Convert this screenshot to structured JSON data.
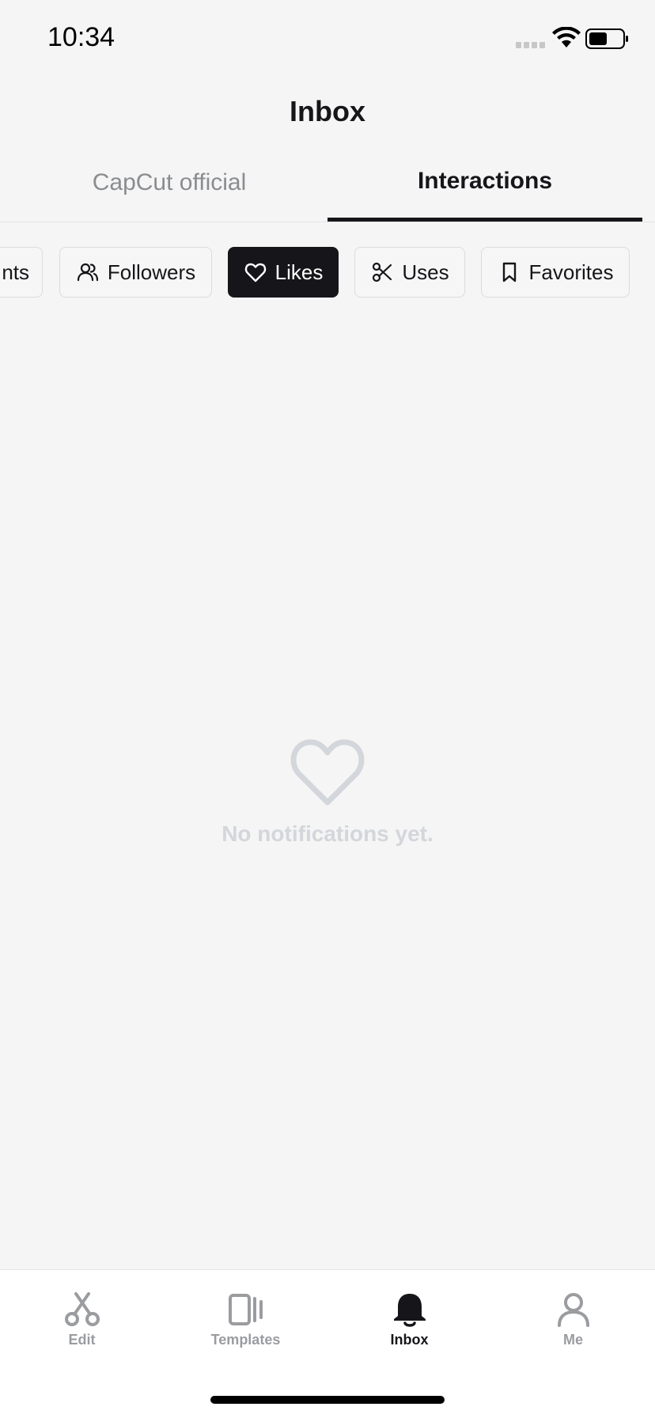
{
  "status_bar": {
    "time": "10:34"
  },
  "header": {
    "title": "Inbox"
  },
  "top_tabs": [
    {
      "label": "CapCut official",
      "selected": false
    },
    {
      "label": "Interactions",
      "selected": true
    }
  ],
  "filter_chips": [
    {
      "label": "nts",
      "icon": "truncated",
      "selected": false
    },
    {
      "label": "Followers",
      "icon": "users-icon",
      "selected": false
    },
    {
      "label": "Likes",
      "icon": "heart-icon",
      "selected": true
    },
    {
      "label": "Uses",
      "icon": "scissors-icon",
      "selected": false
    },
    {
      "label": "Favorites",
      "icon": "bookmark-icon",
      "selected": false
    }
  ],
  "empty_state": {
    "icon": "heart-icon",
    "message": "No notifications yet."
  },
  "bottom_nav": [
    {
      "label": "Edit",
      "icon": "scissors-icon",
      "selected": false
    },
    {
      "label": "Templates",
      "icon": "templates-icon",
      "selected": false
    },
    {
      "label": "Inbox",
      "icon": "bell-icon",
      "selected": true
    },
    {
      "label": "Me",
      "icon": "person-icon",
      "selected": false
    }
  ],
  "colors": {
    "background": "#f5f5f5",
    "text_primary": "#16161a",
    "text_muted": "#8a8c90",
    "chip_active": "#16161a",
    "empty_state": "#d3d6da"
  }
}
